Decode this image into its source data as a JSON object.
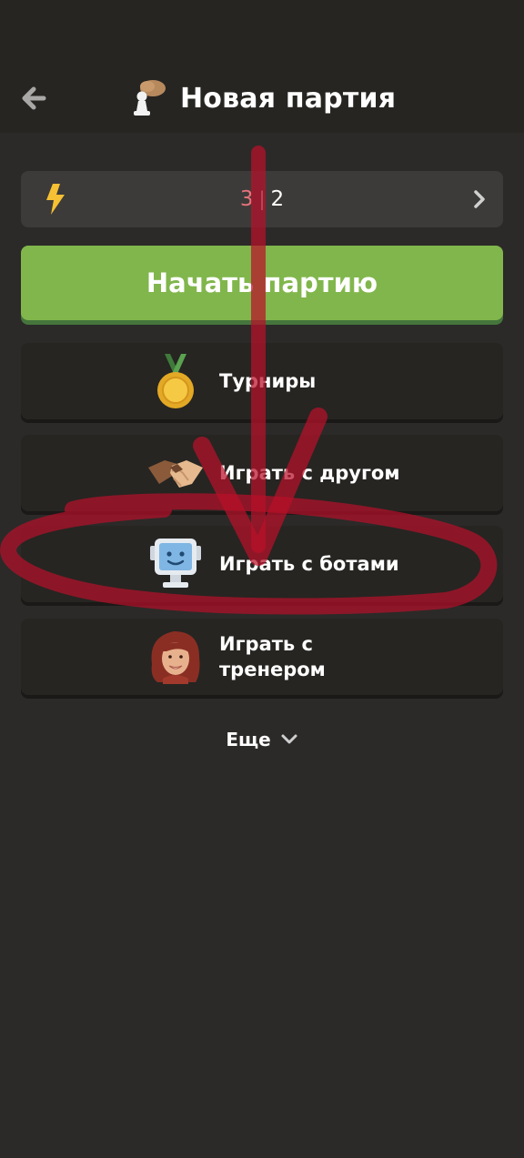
{
  "header": {
    "title": "Новая партия",
    "back_icon": "arrow-left-icon",
    "title_icon": "hand-with-pawn-icon"
  },
  "time_control": {
    "icon": "lightning-bolt-icon",
    "minutes": "3",
    "separator": "|",
    "increment": "2",
    "chevron_icon": "chevron-right-icon"
  },
  "start_button": {
    "label": "Начать партию"
  },
  "options": [
    {
      "label": "Турниры",
      "icon": "gold-medal-icon"
    },
    {
      "label": "Играть с другом",
      "icon": "handshake-icon"
    },
    {
      "label": "Играть с ботами",
      "icon": "computer-bot-icon"
    },
    {
      "label": "Играть с тренером",
      "icon": "coach-avatar-icon"
    }
  ],
  "more": {
    "label": "Еще",
    "icon": "chevron-down-icon"
  },
  "colors": {
    "background": "#2b2a28",
    "header": "#262522",
    "card": "#262522",
    "time_control_bg": "#3c3b39",
    "start_green": "#81b64c",
    "minutes_red": "#e4737c",
    "bolt_yellow": "#f5c033",
    "annotation_red": "#c8102e"
  }
}
